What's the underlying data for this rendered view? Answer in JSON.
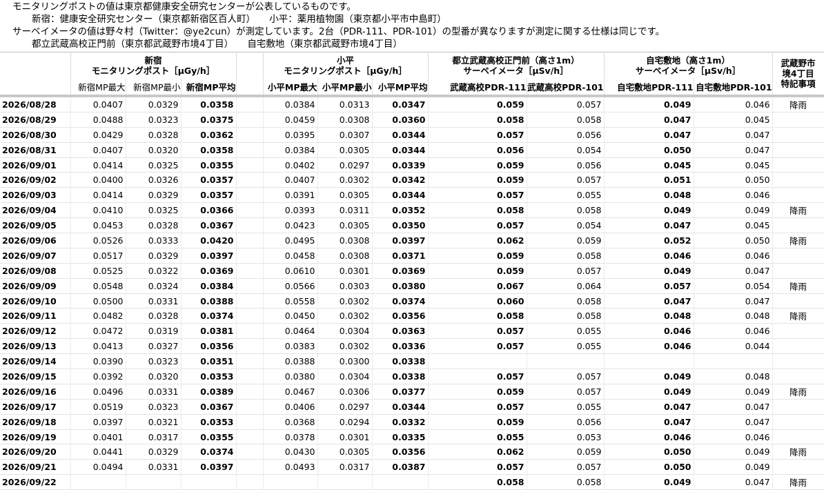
{
  "notes": [
    "モニタリングポストの値は東京都健康安全研究センターが公表しているものです。",
    "新宿：健康安全研究センター（東京都新宿区百人町）　　小平：薬用植物園（東京都小平市中島町）",
    "サーベイメータの値は野々村（Twitter：@ye2cun）が測定しています。2台（PDR-111、PDR-101）の型番が異なりますが測定に関する仕様は同じです。",
    "都立武蔵高校正門前（東京都武蔵野市境4丁目）　　自宅敷地（東京都武蔵野市境4丁目）"
  ],
  "groups": {
    "shinjuku": {
      "line1": "新宿",
      "line2": "モニタリングポスト［μGy/h］"
    },
    "kodaira": {
      "line1": "小平",
      "line2": "モニタリングポスト［μGy/h］"
    },
    "musashi": {
      "line1": "都立武蔵高校正門前（高さ1m）",
      "line2": "サーベイメータ［μSv/h］"
    },
    "home": {
      "line1": "自宅敷地（高さ1m）",
      "line2": "サーベイメータ［μSv/h］"
    },
    "remarks": {
      "line1": "武蔵野市",
      "line2": "境4丁目",
      "line3": "特記事項"
    }
  },
  "columns": [
    "新宿MP最大",
    "新宿MP最小",
    "新宿MP平均",
    "小平MP最大",
    "小平MP最小",
    "小平MP平均",
    "武蔵高校PDR-111",
    "武蔵高校PDR-101",
    "自宅敷地PDR-111",
    "自宅敷地PDR-101"
  ],
  "rows": [
    [
      "2026/08/28",
      "0.0407",
      "0.0329",
      "0.0358",
      "0.0384",
      "0.0313",
      "0.0347",
      "0.059",
      "0.057",
      "0.049",
      "0.046",
      "降雨"
    ],
    [
      "2026/08/29",
      "0.0488",
      "0.0323",
      "0.0375",
      "0.0459",
      "0.0308",
      "0.0360",
      "0.058",
      "0.058",
      "0.047",
      "0.045",
      ""
    ],
    [
      "2026/08/30",
      "0.0429",
      "0.0328",
      "0.0362",
      "0.0395",
      "0.0307",
      "0.0344",
      "0.057",
      "0.056",
      "0.047",
      "0.047",
      ""
    ],
    [
      "2026/08/31",
      "0.0407",
      "0.0320",
      "0.0358",
      "0.0384",
      "0.0305",
      "0.0344",
      "0.056",
      "0.054",
      "0.050",
      "0.047",
      ""
    ],
    [
      "2026/09/01",
      "0.0414",
      "0.0325",
      "0.0355",
      "0.0402",
      "0.0297",
      "0.0339",
      "0.059",
      "0.056",
      "0.045",
      "0.045",
      ""
    ],
    [
      "2026/09/02",
      "0.0400",
      "0.0326",
      "0.0357",
      "0.0407",
      "0.0302",
      "0.0342",
      "0.059",
      "0.057",
      "0.051",
      "0.050",
      ""
    ],
    [
      "2026/09/03",
      "0.0414",
      "0.0329",
      "0.0357",
      "0.0391",
      "0.0305",
      "0.0344",
      "0.057",
      "0.055",
      "0.048",
      "0.046",
      ""
    ],
    [
      "2026/09/04",
      "0.0410",
      "0.0325",
      "0.0366",
      "0.0393",
      "0.0311",
      "0.0352",
      "0.058",
      "0.058",
      "0.049",
      "0.049",
      "降雨"
    ],
    [
      "2026/09/05",
      "0.0453",
      "0.0328",
      "0.0367",
      "0.0423",
      "0.0305",
      "0.0350",
      "0.057",
      "0.054",
      "0.047",
      "0.045",
      ""
    ],
    [
      "2026/09/06",
      "0.0526",
      "0.0333",
      "0.0420",
      "0.0495",
      "0.0308",
      "0.0397",
      "0.062",
      "0.059",
      "0.052",
      "0.050",
      "降雨"
    ],
    [
      "2026/09/07",
      "0.0517",
      "0.0329",
      "0.0397",
      "0.0458",
      "0.0308",
      "0.0371",
      "0.059",
      "0.058",
      "0.046",
      "0.046",
      ""
    ],
    [
      "2026/09/08",
      "0.0525",
      "0.0322",
      "0.0369",
      "0.0610",
      "0.0301",
      "0.0369",
      "0.059",
      "0.057",
      "0.049",
      "0.047",
      ""
    ],
    [
      "2026/09/09",
      "0.0548",
      "0.0324",
      "0.0384",
      "0.0566",
      "0.0303",
      "0.0380",
      "0.067",
      "0.064",
      "0.057",
      "0.054",
      "降雨"
    ],
    [
      "2026/09/10",
      "0.0500",
      "0.0331",
      "0.0388",
      "0.0558",
      "0.0302",
      "0.0374",
      "0.060",
      "0.058",
      "0.047",
      "0.047",
      ""
    ],
    [
      "2026/09/11",
      "0.0482",
      "0.0328",
      "0.0374",
      "0.0450",
      "0.0302",
      "0.0356",
      "0.058",
      "0.058",
      "0.048",
      "0.048",
      "降雨"
    ],
    [
      "2026/09/12",
      "0.0472",
      "0.0319",
      "0.0381",
      "0.0464",
      "0.0304",
      "0.0363",
      "0.057",
      "0.055",
      "0.046",
      "0.046",
      ""
    ],
    [
      "2026/09/13",
      "0.0413",
      "0.0327",
      "0.0356",
      "0.0383",
      "0.0302",
      "0.0336",
      "0.057",
      "0.055",
      "0.046",
      "0.044",
      ""
    ],
    [
      "2026/09/14",
      "0.0390",
      "0.0323",
      "0.0351",
      "0.0388",
      "0.0300",
      "0.0338",
      "",
      "",
      "",
      "",
      ""
    ],
    [
      "2026/09/15",
      "0.0392",
      "0.0320",
      "0.0353",
      "0.0380",
      "0.0304",
      "0.0338",
      "0.057",
      "0.057",
      "0.049",
      "0.048",
      ""
    ],
    [
      "2026/09/16",
      "0.0496",
      "0.0331",
      "0.0389",
      "0.0467",
      "0.0306",
      "0.0377",
      "0.059",
      "0.057",
      "0.049",
      "0.049",
      "降雨"
    ],
    [
      "2026/09/17",
      "0.0519",
      "0.0323",
      "0.0367",
      "0.0406",
      "0.0297",
      "0.0344",
      "0.057",
      "0.055",
      "0.047",
      "0.047",
      ""
    ],
    [
      "2026/09/18",
      "0.0397",
      "0.0321",
      "0.0353",
      "0.0368",
      "0.0294",
      "0.0332",
      "0.059",
      "0.056",
      "0.047",
      "0.047",
      ""
    ],
    [
      "2026/09/19",
      "0.0401",
      "0.0317",
      "0.0355",
      "0.0378",
      "0.0301",
      "0.0335",
      "0.055",
      "0.053",
      "0.046",
      "0.046",
      ""
    ],
    [
      "2026/09/20",
      "0.0441",
      "0.0329",
      "0.0374",
      "0.0430",
      "0.0305",
      "0.0356",
      "0.062",
      "0.059",
      "0.050",
      "0.049",
      "降雨"
    ],
    [
      "2026/09/21",
      "0.0494",
      "0.0331",
      "0.0397",
      "0.0493",
      "0.0317",
      "0.0387",
      "0.057",
      "0.057",
      "0.050",
      "0.049",
      ""
    ],
    [
      "2026/09/22",
      "",
      "",
      "",
      "",
      "",
      "",
      "0.058",
      "0.058",
      "0.049",
      "0.047",
      "降雨"
    ]
  ]
}
